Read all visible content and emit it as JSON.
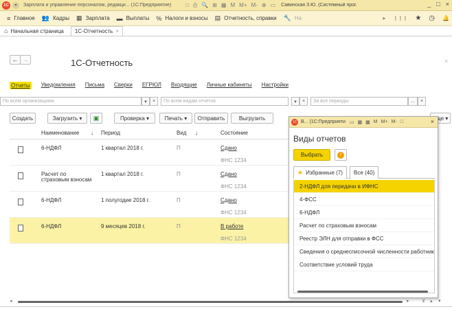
{
  "titlebar": {
    "logo": "1С",
    "title": "Зарплата и управление персоналом, редакци... (1С:Предприятие)",
    "icons": [
      "□",
      "⎙",
      "🔍",
      "⊞",
      "▦",
      "M",
      "M+",
      "M-",
      "⊕",
      "▭"
    ],
    "user": "Савинская З.Ю. (Системный прог...",
    "minimize": "_",
    "maximize": "□",
    "close": "×"
  },
  "mainmenu": {
    "items": [
      {
        "icon": "≡",
        "label": "Главное"
      },
      {
        "icon": "👥",
        "label": "Кадры"
      },
      {
        "icon": "▦",
        "label": "Зарплата"
      },
      {
        "icon": "▬",
        "label": "Выплаты"
      },
      {
        "icon": "%",
        "label": "Налоги и взносы"
      },
      {
        "icon": "▤",
        "label": "Отчетность, справки"
      },
      {
        "icon": "🔧",
        "label": "На"
      }
    ],
    "right_icons": [
      "▸",
      "⋮⋮⋮",
      "★",
      "◷",
      "🔔"
    ]
  },
  "tabs": {
    "home_label": "Начальная страница",
    "active_tab": "1С-Отчетность",
    "close": "×"
  },
  "form": {
    "title": "1С-Отчетность",
    "back": "←",
    "forward": "→",
    "close": "×"
  },
  "sections": [
    "Отчеты",
    "Уведомления",
    "Письма",
    "Сверки",
    "ЕГРЮЛ",
    "Входящие",
    "Личные кабинеты",
    "Настройки"
  ],
  "filters": {
    "org_placeholder": "По всем организациям",
    "kind_placeholder": "По всем видам отчетов",
    "period_placeholder": "За все периоды",
    "dropdown": "▾",
    "clear": "×",
    "more": "..."
  },
  "toolbar": {
    "create": "Создать",
    "load": "Загрузить",
    "check": "Проверка",
    "print": "Печать",
    "send": "Отправить",
    "upload": "Выгрузить",
    "more": "Еще"
  },
  "table": {
    "headers": {
      "name": "Наименование",
      "period": "Период",
      "kind": "Вид",
      "status": "Состояние"
    },
    "sort_icon": "↓",
    "rows": [
      {
        "name": "6-НДФЛ",
        "name2": "",
        "period": "1 квартал 2018 г.",
        "kind": "П",
        "status": "Сдано",
        "sub": "ФНС 1234"
      },
      {
        "name": "Расчет по",
        "name2": "страховым взносам",
        "period": "1 квартал 2018 г.",
        "kind": "П",
        "status": "Сдано",
        "sub": "ФНС 1234"
      },
      {
        "name": "6-НДФЛ",
        "name2": "",
        "period": "1 полугодие 2018 г.",
        "kind": "П",
        "status": "Сдано",
        "sub": "ФНС 1234"
      },
      {
        "name": "6-НДФЛ",
        "name2": "",
        "period": "9 месяцев 2018 г.",
        "kind": "П",
        "status": "В работе",
        "sub": "ФНС 1234"
      }
    ]
  },
  "popup": {
    "window_title": "В... (1С:Предприяти",
    "icons": [
      "▭",
      "▦",
      "▦",
      "M",
      "M+",
      "M-",
      "□"
    ],
    "close": "×",
    "heading": "Виды отчетов",
    "select": "Выбрать",
    "info": "i",
    "tab_favorites": "Избранные (7)",
    "tab_all": "Все (40)",
    "items": [
      "2-НДФЛ для передачи в ИФНС",
      "4-ФСС",
      "6-НДФЛ",
      "Расчет по страховым взносам",
      "Реестр ЭЛН для отправки в ФСС",
      "Сведения о среднесписочной численности работников",
      "Соответствие условий труда"
    ]
  },
  "colors": {
    "titlebar": "#f5e7a8",
    "menubar": "#fbf3d2",
    "accent": "#f5d300",
    "selected_row": "#fbf2a5"
  }
}
